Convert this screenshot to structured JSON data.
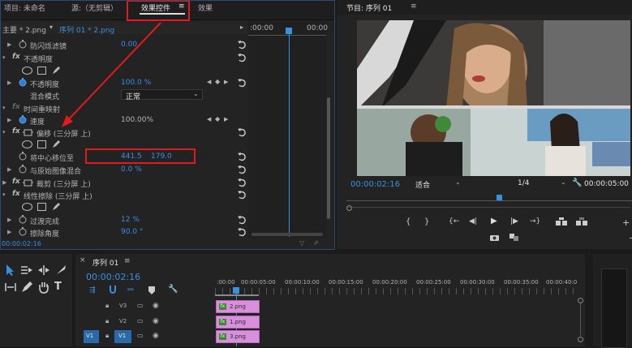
{
  "source_panel": {
    "tabs": [
      "项目: 未命名",
      "源:（无剪辑）",
      "效果控件",
      "效果"
    ],
    "active_tab_menu": "≡",
    "clip_selector": "主要 * 2.png",
    "sequence_link": "序列 01 * 2.png",
    "ruler_start": ":00:00",
    "ruler_end": "00:00",
    "timecode": "00:00:02:16",
    "rows": [
      {
        "label": "防闪烁滤镜",
        "value": "0.00"
      },
      {
        "label": "不透明度"
      },
      {
        "label": "不透明度",
        "value": "100.0 %"
      },
      {
        "label": "混合模式",
        "value": "正常"
      },
      {
        "label": "时间重映射"
      },
      {
        "label": "速度",
        "value": "100.00%"
      },
      {
        "label": "偏移 (三分屏 上)"
      },
      {
        "label": "将中心移位至",
        "value1": "441.5",
        "value2": "179.0"
      },
      {
        "label": "与原始图像混合",
        "value": "0.0 %"
      },
      {
        "label": "裁剪 (三分屏 上)"
      },
      {
        "label": "线性擦除 (三分屏 上)"
      },
      {
        "label": "过渡完成",
        "value": "12 %"
      },
      {
        "label": "擦除角度",
        "value": "90.0 °"
      }
    ]
  },
  "program_monitor": {
    "title": "节目: 序列 01",
    "menu": "≡",
    "timecode": "00:00:02:16",
    "fit": "适合",
    "resolution": "1/4",
    "duration": "00:00:05:00",
    "transport": [
      "{",
      "}",
      "{←",
      "◀|",
      "▶",
      "|▶",
      "→}"
    ]
  },
  "timeline": {
    "close": "×",
    "title": "序列 01",
    "menu": "≡",
    "timecode": "00:00:02:16",
    "ruler": [
      ":00:00",
      "00:00:05:00",
      "00:00:10:00",
      "00:00:15:00",
      "00:00:20:00",
      "00:00:25:00",
      "00:00:30:00",
      "00:00:35:00",
      "00:00:40:0"
    ],
    "tracks": [
      {
        "name": "V3",
        "clip": "2.png"
      },
      {
        "name": "V2",
        "clip": "1.png"
      },
      {
        "name": "V1",
        "clip": "3.png",
        "source": "V1"
      }
    ]
  },
  "colors": {
    "accent_blue": "#3a8fe0",
    "highlight_red": "#e01b1b",
    "clip_pink": "#d88fdc",
    "panel_bg": "#232323"
  }
}
